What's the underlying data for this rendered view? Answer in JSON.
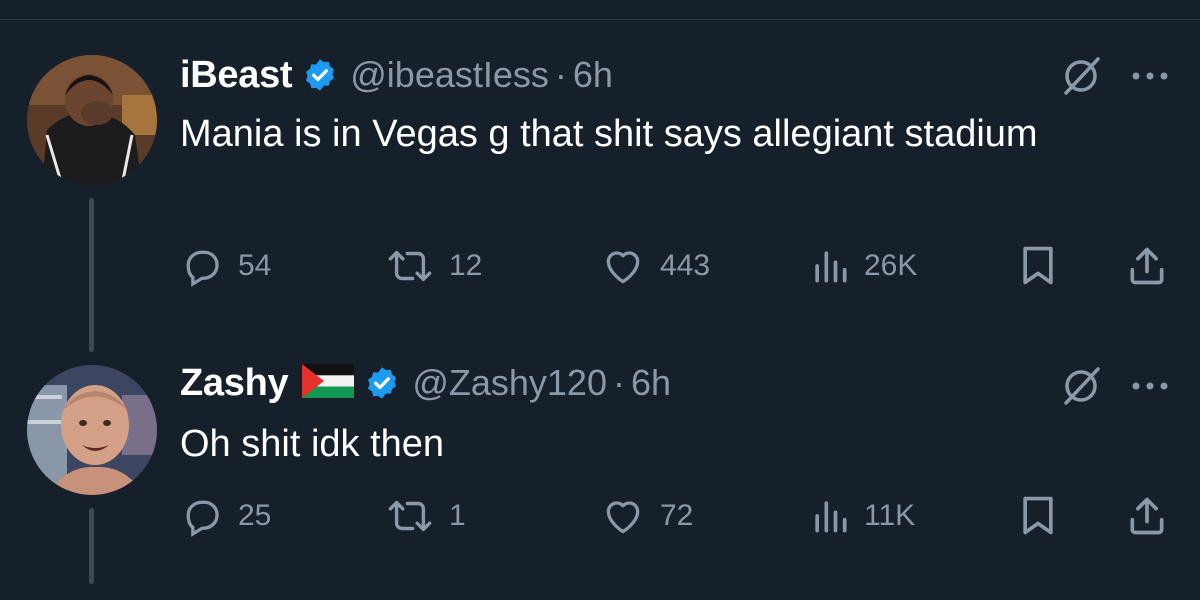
{
  "tweets": [
    {
      "display_name": "iBeast",
      "handle": "@ibeastIess",
      "separator": "·",
      "time": "6h",
      "text": "Mania is in Vegas g that shit says allegiant stadium",
      "verified": true,
      "flag": "",
      "stats": {
        "replies": "54",
        "retweets": "12",
        "likes": "443",
        "views": "26K"
      }
    },
    {
      "display_name": "Zashy",
      "handle": "@Zashy120",
      "separator": "·",
      "time": "6h",
      "text": "Oh shit idk then",
      "verified": true,
      "flag": "palestine-flag",
      "stats": {
        "replies": "25",
        "retweets": "1",
        "likes": "72",
        "views": "11K"
      }
    }
  ],
  "colors": {
    "background": "#15202b",
    "text": "#ffffff",
    "secondary_text": "#8b98a5",
    "verified_badge": "#1d9bf0",
    "thread_line": "#3d4a56"
  },
  "icons": [
    "reply-icon",
    "retweet-icon",
    "like-icon",
    "views-icon",
    "bookmark-icon",
    "share-icon",
    "grok-icon",
    "more-icon",
    "verified-icon"
  ]
}
